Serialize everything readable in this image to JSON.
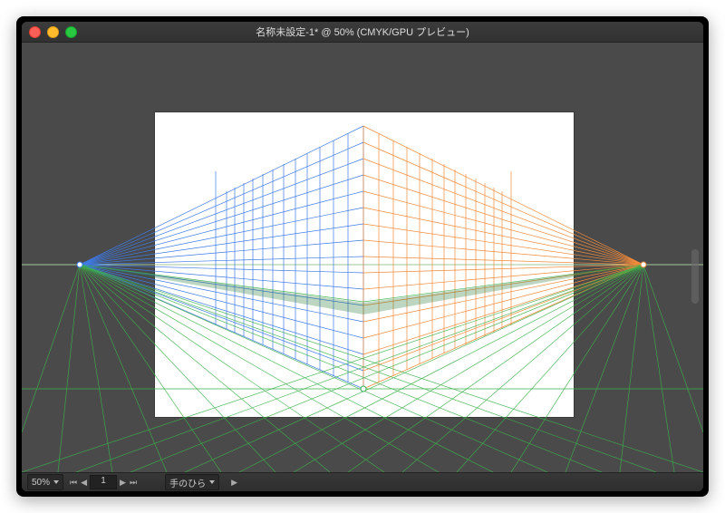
{
  "titlebar": {
    "title": "名称未設定-1* @ 50% (CMYK/GPU プレビュー)"
  },
  "statusbar": {
    "zoom": "50%",
    "page": "1",
    "tool": "手のひら"
  },
  "canvas": {
    "colors": {
      "left_face": "#3e7ae6",
      "right_face": "#f08b3c",
      "ground": "#3cb04a",
      "horizon": "#a3c49a"
    }
  }
}
